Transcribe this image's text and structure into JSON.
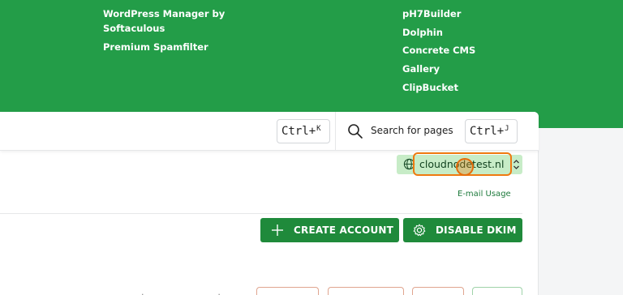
{
  "hero": {
    "left_links": [
      "WordPress Manager by",
      "Softaculous",
      "Premium Spamfilter"
    ],
    "right_links": [
      "pH7Builder",
      "Dolphin",
      "Concrete CMS",
      "Gallery",
      "ClipBucket"
    ]
  },
  "topbar": {
    "shortcut_left": {
      "key": "Ctrl+",
      "sup": "K"
    },
    "search_label": "Search for pages",
    "shortcut_right": {
      "key": "Ctrl+",
      "sup": "J"
    }
  },
  "domain_select": {
    "value": "cloudnodetest.nl",
    "icon": "globe-icon"
  },
  "email_usage_link": "E-mail Usage",
  "actions": {
    "create_account": "CREATE ACCOUNT",
    "disable_dkim": "DISABLE DKIM"
  },
  "colors": {
    "hero_bg": "#239d48",
    "button_bg": "#1f8a3b",
    "domain_bg": "#c7ecc7",
    "focus_ring": "#ef7a10"
  }
}
